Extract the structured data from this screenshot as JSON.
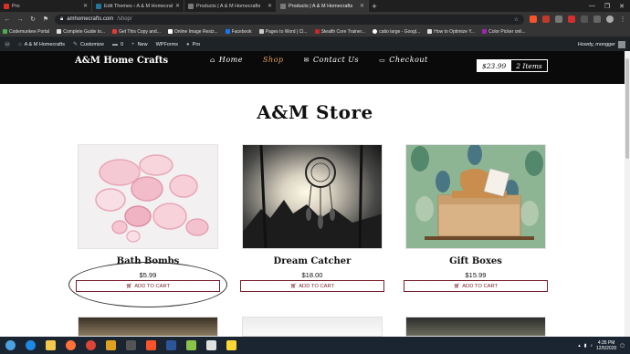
{
  "browser": {
    "tabs": [
      {
        "label": "Pro",
        "active": false
      },
      {
        "label": "Edit Themes ‹ A & M Homecrafts",
        "active": false
      },
      {
        "label": "Products | A & M Homecrafts",
        "active": false
      },
      {
        "label": "Products | A & M Homecrafts",
        "active": true
      }
    ],
    "new_tab": "+",
    "window_controls": {
      "minimize": "—",
      "maximize": "❐",
      "close": "✕"
    },
    "url_host": "amhomecrafts.com",
    "url_path": "/shop/",
    "bookmarks": [
      "Codemunkee Portal",
      "Complete Guide to...",
      "Get This Copy and...",
      "Online Image Resiz...",
      "Facebook",
      "Pages to Word | Cl...",
      "Stealth Core Trainer...",
      "catio large - Googl...",
      "How to Optimize Y...",
      "Color Picker onli..."
    ]
  },
  "admin_bar": {
    "site_name": "A & M Homecrafts",
    "customize": "Customize",
    "comments": "0",
    "new": "New",
    "wpforms": "WPForms",
    "pro": "Pro",
    "howdy": "Howdy, mongger"
  },
  "site": {
    "brand": "A&M Home Crafts",
    "nav": [
      {
        "label": "Home",
        "icon": "home-icon",
        "glyph": "⌂",
        "current": false
      },
      {
        "label": "Shop",
        "icon": "",
        "glyph": "",
        "current": true
      },
      {
        "label": "Contact Us",
        "icon": "envelope-icon",
        "glyph": "✉",
        "current": false
      },
      {
        "label": "Checkout",
        "icon": "card-icon",
        "glyph": "▭",
        "current": false
      }
    ],
    "cart": {
      "amount": "$23.99",
      "items": "2 Items"
    }
  },
  "page": {
    "title": "A&M Store",
    "products": [
      {
        "name": "Bath Bombs",
        "price": "$5.99",
        "button": "ADD TO CART"
      },
      {
        "name": "Dream Catcher",
        "price": "$18.00",
        "button": "ADD TO CART"
      },
      {
        "name": "Gift Boxes",
        "price": "$15.99",
        "button": "ADD TO CART"
      }
    ]
  },
  "taskbar": {
    "time": "4:35 PM",
    "date": "12/5/2020"
  },
  "colors": {
    "header_bg": "#0a0a0a",
    "nav_current": "#e6a15c",
    "button_border": "#7a1f2b",
    "admin_bar": "#1d2327"
  }
}
